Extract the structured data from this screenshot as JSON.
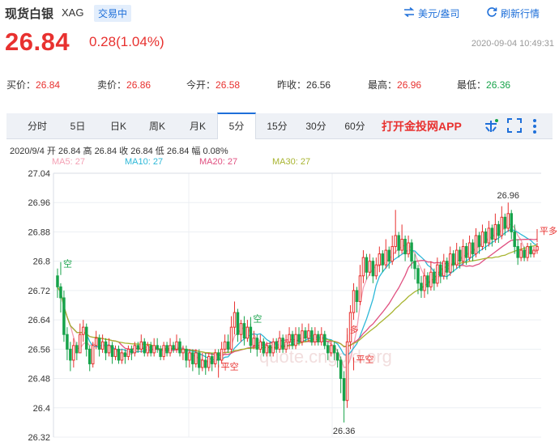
{
  "header": {
    "name": "现货白银",
    "code": "XAG",
    "status": "交易中",
    "tools": [
      {
        "label": "美元/盎司",
        "icon": "swap-icon"
      },
      {
        "label": "刷新行情",
        "icon": "refresh-icon"
      }
    ],
    "price": "26.84",
    "change": "0.28(1.04%)",
    "datetime": "2020-09-04 10:49:31"
  },
  "stats": [
    {
      "label": "买价：",
      "value": "26.84",
      "tone": "red"
    },
    {
      "label": "卖价：",
      "value": "26.86",
      "tone": "red"
    },
    {
      "label": "今开：",
      "value": "26.58",
      "tone": "red"
    },
    {
      "label": "昨收：",
      "value": "26.56",
      "tone": "dark"
    },
    {
      "label": "最高：",
      "value": "26.96",
      "tone": "red"
    },
    {
      "label": "最低：",
      "value": "26.36",
      "tone": "green"
    }
  ],
  "tabs": [
    "分时",
    "5日",
    "日K",
    "周K",
    "月K",
    "5分",
    "15分",
    "30分",
    "60分"
  ],
  "active_tab": "5分",
  "app_link": "打开金投网APP",
  "tab_icons": [
    "share-icon",
    "fullscreen-icon",
    "more-icon"
  ],
  "bar_info": "2020/9/4  开 26.84  高 26.84  收 26.84  低 26.84  幅 0.08%",
  "ma_legend": [
    {
      "label": "MA5: 27",
      "color": "#f4a0b4"
    },
    {
      "label": "MA10: 27",
      "color": "#2db8d8"
    },
    {
      "label": "MA20: 27",
      "color": "#e05080"
    },
    {
      "label": "MA30: 27",
      "color": "#a8b430"
    }
  ],
  "colors": {
    "up": "#e8312f",
    "down": "#17a34a",
    "accent": "#1e6fd9"
  },
  "watermark": "quote.cngold.org",
  "chart_data": {
    "type": "candlestick",
    "y_ticks": [
      "27.04",
      "26.96",
      "26.88",
      "26.8",
      "26.72",
      "26.64",
      "26.56",
      "26.48",
      "26.4",
      "26.32"
    ],
    "ylim": [
      26.32,
      27.04
    ],
    "high_label": "26.96",
    "low_label": "26.36",
    "signals": [
      {
        "label": "空",
        "index": 1,
        "price": 26.78
      },
      {
        "label": "平空",
        "index": 50,
        "price": 26.5
      },
      {
        "label": "空",
        "index": 60,
        "price": 26.63
      },
      {
        "label": "多",
        "index": 90,
        "price": 26.6
      },
      {
        "label": "平空",
        "index": 92,
        "price": 26.52
      },
      {
        "label": "平多",
        "index": 152,
        "price": 26.87
      }
    ],
    "candles": [
      [
        26.76,
        26.73,
        26.78,
        26.7
      ],
      [
        26.73,
        26.7,
        26.74,
        26.66
      ],
      [
        26.7,
        26.6,
        26.72,
        26.58
      ],
      [
        26.6,
        26.56,
        26.62,
        26.53
      ],
      [
        26.56,
        26.53,
        26.58,
        26.5
      ],
      [
        26.53,
        26.57,
        26.59,
        26.51
      ],
      [
        26.57,
        26.55,
        26.58,
        26.53
      ],
      [
        26.55,
        26.6,
        26.63,
        26.55
      ],
      [
        26.6,
        26.62,
        26.64,
        26.58
      ],
      [
        26.62,
        26.56,
        26.63,
        26.54
      ],
      [
        26.56,
        26.52,
        26.57,
        26.5
      ],
      [
        26.52,
        26.57,
        26.58,
        26.51
      ],
      [
        26.57,
        26.59,
        26.61,
        26.56
      ],
      [
        26.59,
        26.56,
        26.6,
        26.54
      ],
      [
        26.56,
        26.58,
        26.6,
        26.55
      ],
      [
        26.58,
        26.55,
        26.59,
        26.53
      ],
      [
        26.55,
        26.57,
        26.59,
        26.54
      ],
      [
        26.57,
        26.54,
        26.58,
        26.52
      ],
      [
        26.54,
        26.56,
        26.57,
        26.53
      ],
      [
        26.56,
        26.53,
        26.57,
        26.52
      ],
      [
        26.53,
        26.55,
        26.56,
        26.52
      ],
      [
        26.55,
        26.54,
        26.56,
        26.52
      ],
      [
        26.54,
        26.56,
        26.57,
        26.53
      ],
      [
        26.56,
        26.55,
        26.57,
        26.53
      ],
      [
        26.55,
        26.57,
        26.58,
        26.54
      ],
      [
        26.57,
        26.56,
        26.58,
        26.55
      ],
      [
        26.56,
        26.58,
        26.6,
        26.55
      ],
      [
        26.58,
        26.55,
        26.59,
        26.54
      ],
      [
        26.55,
        26.57,
        26.58,
        26.54
      ],
      [
        26.57,
        26.55,
        26.58,
        26.54
      ],
      [
        26.55,
        26.57,
        26.59,
        26.54
      ],
      [
        26.57,
        26.56,
        26.59,
        26.55
      ],
      [
        26.56,
        26.54,
        26.57,
        26.53
      ],
      [
        26.54,
        26.57,
        26.58,
        26.53
      ],
      [
        26.57,
        26.55,
        26.58,
        26.54
      ],
      [
        26.55,
        26.57,
        26.59,
        26.54
      ],
      [
        26.57,
        26.56,
        26.58,
        26.55
      ],
      [
        26.56,
        26.58,
        26.6,
        26.55
      ],
      [
        26.58,
        26.55,
        26.59,
        26.54
      ],
      [
        26.55,
        26.56,
        26.57,
        26.53
      ],
      [
        26.56,
        26.53,
        26.57,
        26.51
      ],
      [
        26.53,
        26.55,
        26.56,
        26.51
      ],
      [
        26.55,
        26.52,
        26.56,
        26.5
      ],
      [
        26.52,
        26.55,
        26.56,
        26.51
      ],
      [
        26.55,
        26.51,
        26.56,
        26.49
      ],
      [
        26.51,
        26.53,
        26.55,
        26.5
      ],
      [
        26.53,
        26.51,
        26.55,
        26.49
      ],
      [
        26.51,
        26.54,
        26.55,
        26.5
      ],
      [
        26.54,
        26.52,
        26.55,
        26.5
      ],
      [
        26.52,
        26.55,
        26.56,
        26.51
      ],
      [
        26.55,
        26.53,
        26.56,
        26.51
      ],
      [
        26.53,
        26.56,
        26.58,
        26.52
      ],
      [
        26.56,
        26.58,
        26.6,
        26.55
      ],
      [
        26.58,
        26.56,
        26.6,
        26.55
      ],
      [
        26.56,
        26.62,
        26.65,
        26.55
      ],
      [
        26.62,
        26.66,
        26.69,
        26.6
      ],
      [
        26.66,
        26.6,
        26.67,
        26.58
      ],
      [
        26.6,
        26.63,
        26.64,
        26.58
      ],
      [
        26.63,
        26.59,
        26.65,
        26.57
      ],
      [
        26.59,
        26.62,
        26.64,
        26.58
      ],
      [
        26.62,
        26.57,
        26.63,
        26.55
      ],
      [
        26.57,
        26.59,
        26.61,
        26.56
      ],
      [
        26.59,
        26.56,
        26.6,
        26.54
      ],
      [
        26.56,
        26.58,
        26.6,
        26.55
      ],
      [
        26.58,
        26.55,
        26.59,
        26.54
      ],
      [
        26.55,
        26.57,
        26.58,
        26.54
      ],
      [
        26.57,
        26.55,
        26.58,
        26.54
      ],
      [
        26.55,
        26.58,
        26.59,
        26.54
      ],
      [
        26.58,
        26.56,
        26.59,
        26.55
      ],
      [
        26.56,
        26.59,
        26.61,
        26.55
      ],
      [
        26.59,
        26.56,
        26.6,
        26.55
      ],
      [
        26.56,
        26.58,
        26.6,
        26.55
      ],
      [
        26.58,
        26.6,
        26.62,
        26.56
      ],
      [
        26.6,
        26.57,
        26.61,
        26.56
      ],
      [
        26.57,
        26.6,
        26.62,
        26.56
      ],
      [
        26.6,
        26.58,
        26.62,
        26.57
      ],
      [
        26.58,
        26.61,
        26.63,
        26.57
      ],
      [
        26.61,
        26.59,
        26.62,
        26.58
      ],
      [
        26.59,
        26.61,
        26.63,
        26.58
      ],
      [
        26.61,
        26.58,
        26.62,
        26.57
      ],
      [
        26.58,
        26.6,
        26.62,
        26.57
      ],
      [
        26.6,
        26.58,
        26.61,
        26.57
      ],
      [
        26.58,
        26.6,
        26.62,
        26.57
      ],
      [
        26.6,
        26.57,
        26.61,
        26.56
      ],
      [
        26.57,
        26.55,
        26.58,
        26.53
      ],
      [
        26.55,
        26.57,
        26.58,
        26.54
      ],
      [
        26.57,
        26.55,
        26.58,
        26.53
      ],
      [
        26.55,
        26.53,
        26.56,
        26.51
      ],
      [
        26.53,
        26.48,
        26.54,
        26.44
      ],
      [
        26.48,
        26.42,
        26.5,
        26.36
      ],
      [
        26.42,
        26.58,
        26.6,
        26.4
      ],
      [
        26.58,
        26.66,
        26.68,
        26.56
      ],
      [
        26.66,
        26.72,
        26.74,
        26.64
      ],
      [
        26.72,
        26.69,
        26.73,
        26.66
      ],
      [
        26.69,
        26.76,
        26.79,
        26.68
      ],
      [
        26.76,
        26.81,
        26.83,
        26.74
      ],
      [
        26.81,
        26.77,
        26.82,
        26.75
      ],
      [
        26.77,
        26.8,
        26.82,
        26.76
      ],
      [
        26.8,
        26.76,
        26.81,
        26.74
      ],
      [
        26.76,
        26.79,
        26.81,
        26.75
      ],
      [
        26.79,
        26.82,
        26.84,
        26.77
      ],
      [
        26.82,
        26.79,
        26.83,
        26.77
      ],
      [
        26.79,
        26.83,
        26.86,
        26.78
      ],
      [
        26.83,
        26.8,
        26.84,
        26.78
      ],
      [
        26.8,
        26.84,
        26.87,
        26.79
      ],
      [
        26.84,
        26.87,
        26.94,
        26.82
      ],
      [
        26.87,
        26.83,
        26.88,
        26.81
      ],
      [
        26.83,
        26.86,
        26.9,
        26.82
      ],
      [
        26.86,
        26.82,
        26.87,
        26.8
      ],
      [
        26.82,
        26.85,
        26.87,
        26.81
      ],
      [
        26.85,
        26.8,
        26.86,
        26.78
      ],
      [
        26.8,
        26.78,
        26.82,
        26.75
      ],
      [
        26.78,
        26.74,
        26.79,
        26.71
      ],
      [
        26.74,
        26.72,
        26.76,
        26.7
      ],
      [
        26.72,
        26.76,
        26.78,
        26.7
      ],
      [
        26.76,
        26.73,
        26.77,
        26.71
      ],
      [
        26.73,
        26.77,
        26.8,
        26.72
      ],
      [
        26.77,
        26.74,
        26.78,
        26.72
      ],
      [
        26.74,
        26.79,
        26.81,
        26.73
      ],
      [
        26.79,
        26.76,
        26.8,
        26.74
      ],
      [
        26.76,
        26.8,
        26.82,
        26.75
      ],
      [
        26.8,
        26.77,
        26.81,
        26.75
      ],
      [
        26.77,
        26.82,
        26.84,
        26.76
      ],
      [
        26.82,
        26.79,
        26.83,
        26.77
      ],
      [
        26.79,
        26.83,
        26.85,
        26.78
      ],
      [
        26.83,
        26.8,
        26.84,
        26.78
      ],
      [
        26.8,
        26.84,
        26.86,
        26.79
      ],
      [
        26.84,
        26.81,
        26.85,
        26.79
      ],
      [
        26.81,
        26.85,
        26.87,
        26.8
      ],
      [
        26.85,
        26.82,
        26.86,
        26.8
      ],
      [
        26.82,
        26.87,
        26.89,
        26.81
      ],
      [
        26.87,
        26.84,
        26.88,
        26.82
      ],
      [
        26.84,
        26.88,
        26.9,
        26.83
      ],
      [
        26.88,
        26.85,
        26.89,
        26.83
      ],
      [
        26.85,
        26.89,
        26.91,
        26.84
      ],
      [
        26.89,
        26.86,
        26.9,
        26.84
      ],
      [
        26.86,
        26.9,
        26.93,
        26.85
      ],
      [
        26.9,
        26.87,
        26.91,
        26.85
      ],
      [
        26.87,
        26.92,
        26.95,
        26.86
      ],
      [
        26.92,
        26.89,
        26.93,
        26.87
      ],
      [
        26.89,
        26.93,
        26.96,
        26.88
      ],
      [
        26.93,
        26.88,
        26.94,
        26.86
      ],
      [
        26.88,
        26.84,
        26.9,
        26.82
      ],
      [
        26.84,
        26.81,
        26.86,
        26.79
      ],
      [
        26.81,
        26.83,
        26.85,
        26.8
      ],
      [
        26.83,
        26.81,
        26.84,
        26.8
      ],
      [
        26.81,
        26.84,
        26.85,
        26.8
      ],
      [
        26.84,
        26.82,
        26.85,
        26.81
      ],
      [
        26.82,
        26.83,
        26.84,
        26.81
      ],
      [
        26.83,
        26.84,
        26.85,
        26.82
      ]
    ]
  }
}
